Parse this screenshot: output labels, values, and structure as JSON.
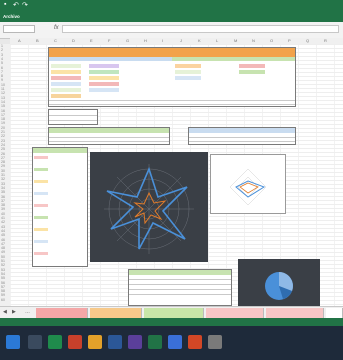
{
  "window": {
    "title": "",
    "status_text": ""
  },
  "ribbon": {
    "tabs": [
      {
        "label": "Archivo"
      },
      {
        "label": ""
      },
      {
        "label": ""
      },
      {
        "label": ""
      },
      {
        "label": ""
      },
      {
        "label": ""
      },
      {
        "label": ""
      },
      {
        "label": ""
      },
      {
        "label": ""
      }
    ],
    "search_label": ""
  },
  "formula_bar": {
    "name_box": "",
    "fx_label": "fx",
    "formula": ""
  },
  "sheet_tabs": [
    {
      "label": "",
      "color": "#f4a7a7"
    },
    {
      "label": "",
      "color": "#f7c98a"
    },
    {
      "label": "",
      "color": "#c8e6a8"
    },
    {
      "label": "",
      "color": "#f7c6c6"
    },
    {
      "label": "",
      "color": "#f7c6c6"
    },
    {
      "label": "",
      "color": "#ffffff"
    }
  ],
  "colors": {
    "excel_green": "#217346",
    "header_orange": "#f2a24a",
    "header_blue": "#c9dcf0",
    "header_green": "#c7e3b0",
    "chart_dark": "#3a3f46",
    "radar_blue": "#4a90d9"
  },
  "icons": [
    "save-icon",
    "undo-icon",
    "redo-icon",
    "windows-start-icon"
  ],
  "clock": {
    "time": ""
  }
}
